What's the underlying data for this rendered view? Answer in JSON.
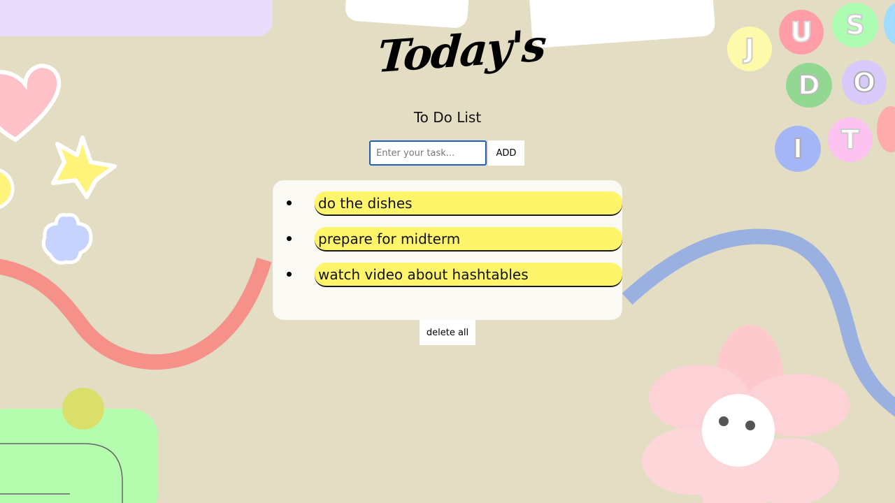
{
  "header": {
    "logo_text": "Today's",
    "subtitle": "To Do List"
  },
  "form": {
    "input_placeholder": "Enter your task...",
    "input_value": "",
    "add_label": "ADD"
  },
  "tasks": [
    {
      "text": "do the dishes"
    },
    {
      "text": "prepare for midterm"
    },
    {
      "text": "watch video about hashtables"
    }
  ],
  "footer": {
    "delete_all_label": "delete all"
  },
  "decorations": {
    "letter_badges": [
      "J",
      "U",
      "S",
      "D",
      "O",
      "I",
      "T"
    ]
  },
  "colors": {
    "background": "#e3ddc3",
    "task_highlight": "#fff56b",
    "panel": "#fbf9f4",
    "input_border": "#1c5fbf"
  }
}
